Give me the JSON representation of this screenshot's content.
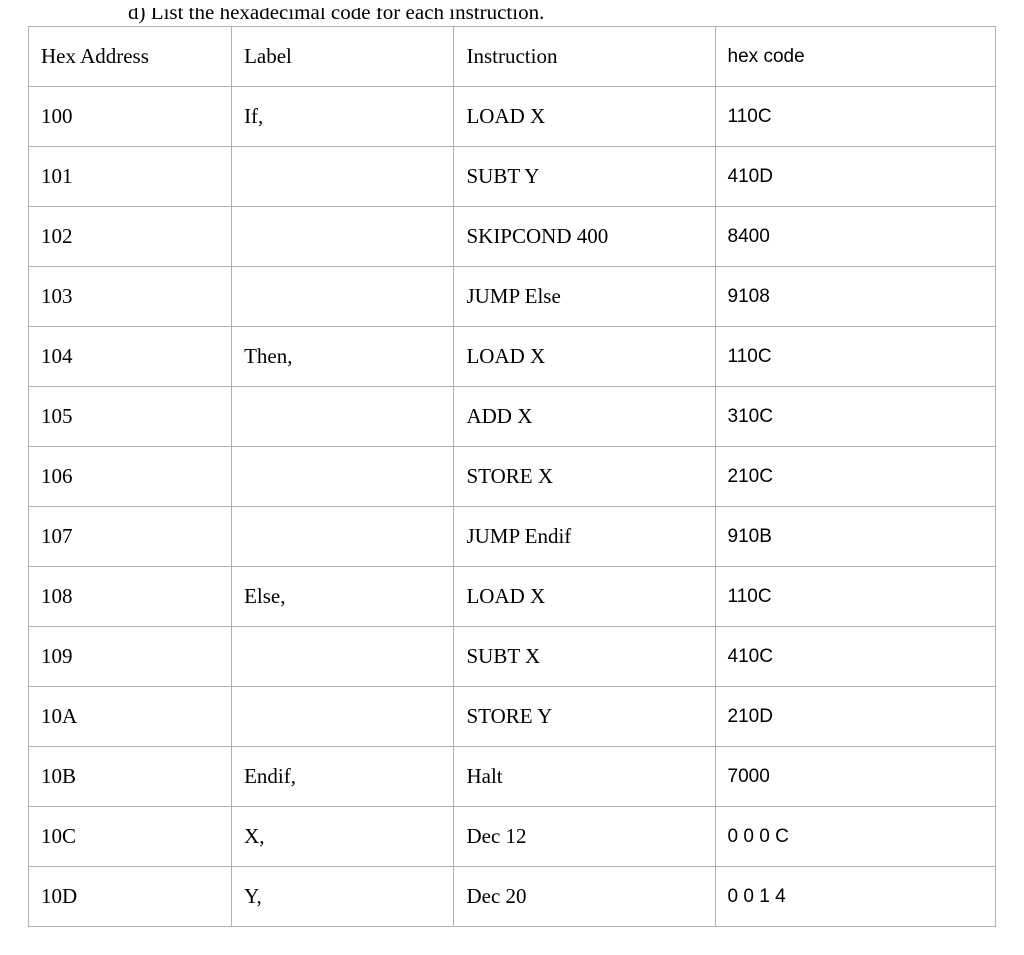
{
  "fragment": "d)   List the hexadecimal code for each instruction.",
  "headers": {
    "col1": "Hex Address",
    "col2": "Label",
    "col3": "Instruction",
    "col4": "hex code"
  },
  "rows": [
    {
      "addr": "100",
      "label": "If,",
      "instr": "LOAD X",
      "hex": "110C"
    },
    {
      "addr": "101",
      "label": "",
      "instr": "SUBT Y",
      "hex": "410D"
    },
    {
      "addr": "102",
      "label": "",
      "instr": "SKIPCOND 400",
      "hex": "8400"
    },
    {
      "addr": "103",
      "label": "",
      "instr": "JUMP Else",
      "hex": "9108"
    },
    {
      "addr": "104",
      "label": "Then,",
      "instr": "LOAD X",
      "hex": "110C"
    },
    {
      "addr": "105",
      "label": "",
      "instr": "ADD X",
      "hex": "310C"
    },
    {
      "addr": "106",
      "label": "",
      "instr": "STORE X",
      "hex": "210C"
    },
    {
      "addr": "107",
      "label": "",
      "instr": "JUMP Endif",
      "hex": "910B"
    },
    {
      "addr": "108",
      "label": "Else,",
      "instr": "LOAD X",
      "hex": "110C"
    },
    {
      "addr": "109",
      "label": "",
      "instr": "SUBT X",
      "hex": "410C"
    },
    {
      "addr": "10A",
      "label": "",
      "instr": "STORE Y",
      "hex": "210D"
    },
    {
      "addr": "10B",
      "label": "Endif,",
      "instr": "Halt",
      "hex": "7000"
    },
    {
      "addr": "10C",
      "label": "X,",
      "instr": "Dec 12",
      "hex": "0 0 0 C"
    },
    {
      "addr": "10D",
      "label": "Y,",
      "instr": "Dec 20",
      "hex": "0 0 1 4"
    }
  ]
}
